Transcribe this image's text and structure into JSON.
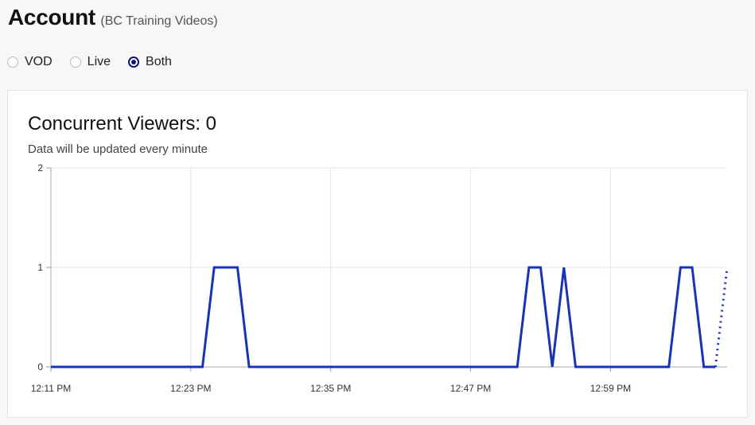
{
  "header": {
    "title": "Account",
    "subtitle": "(BC Training Videos)"
  },
  "filter": {
    "options": [
      {
        "label": "VOD",
        "selected": false
      },
      {
        "label": "Live",
        "selected": false
      },
      {
        "label": "Both",
        "selected": true
      }
    ]
  },
  "card": {
    "title": "Concurrent Viewers: 0",
    "note": "Data will be updated every minute"
  },
  "colors": {
    "series": "#1a33b5",
    "grid": "#e5e5e5",
    "radio_selected": "#12127a"
  },
  "chart_data": {
    "type": "line",
    "x_unit": "minutes",
    "x_ticks": [
      {
        "value": 0,
        "label": "12:11 PM"
      },
      {
        "value": 12,
        "label": "12:23 PM"
      },
      {
        "value": 24,
        "label": "12:35 PM"
      },
      {
        "value": 36,
        "label": "12:47 PM"
      },
      {
        "value": 48,
        "label": "12:59 PM"
      }
    ],
    "y_ticks": [
      0,
      1,
      2
    ],
    "xlim": [
      0,
      58
    ],
    "ylim": [
      0,
      2
    ],
    "grid": true,
    "series": [
      {
        "values": [
          [
            0,
            0
          ],
          [
            13,
            0
          ],
          [
            14,
            1
          ],
          [
            16,
            1
          ],
          [
            17,
            0
          ],
          [
            40,
            0
          ],
          [
            41,
            1
          ],
          [
            42,
            1
          ],
          [
            43,
            0
          ],
          [
            44,
            1
          ],
          [
            45,
            0
          ],
          [
            53,
            0
          ],
          [
            54,
            1
          ],
          [
            55,
            1
          ],
          [
            56,
            0
          ],
          [
            57,
            0
          ]
        ],
        "dashed_tail": [
          [
            57,
            0
          ],
          [
            58,
            1
          ]
        ]
      }
    ]
  }
}
